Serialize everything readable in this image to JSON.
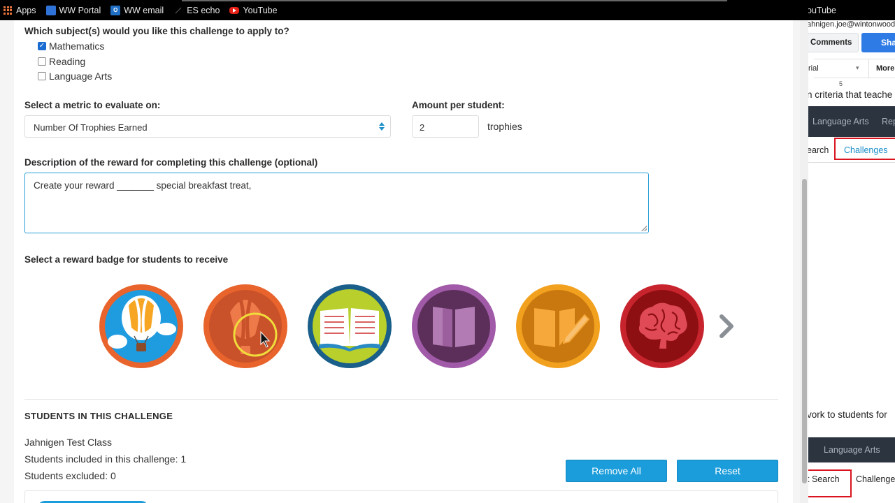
{
  "bookmarks": {
    "items": [
      {
        "label": "Apps",
        "icon": "apps-grid-icon"
      },
      {
        "label": "WW Portal",
        "icon": "portal-icon"
      },
      {
        "label": "WW email",
        "icon": "outlook-icon"
      },
      {
        "label": "ES echo",
        "icon": "echo-icon"
      },
      {
        "label": "YouTube",
        "icon": "youtube-icon"
      }
    ]
  },
  "form": {
    "subjects_label": "Which subject(s) would you like this challenge to apply to?",
    "subjects": [
      {
        "label": "Mathematics",
        "checked": true
      },
      {
        "label": "Reading",
        "checked": false
      },
      {
        "label": "Language Arts",
        "checked": false
      }
    ],
    "metric_label": "Select a metric to evaluate on:",
    "metric_value": "Number Of Trophies Earned",
    "amount_label": "Amount per student:",
    "amount_value": "2",
    "amount_unit": "trophies",
    "description_label": "Description of the reward for completing this challenge (optional)",
    "description_value": "Create your reward _______ special breakfast treat,",
    "badge_label": "Select a reward badge for students to receive",
    "badges": [
      {
        "icon": "hot-air-balloon-icon",
        "ring": "#e8642c",
        "fill": "#1f9be0"
      },
      {
        "icon": "hot-air-balloon-icon",
        "ring": "#e8642c",
        "fill": "#c9522a"
      },
      {
        "icon": "open-book-icon",
        "ring": "#1a5e8a",
        "fill": "#b8cf2c"
      },
      {
        "icon": "book-icon",
        "ring": "#a05aa8",
        "fill": "#5c2f5a"
      },
      {
        "icon": "writing-icon",
        "ring": "#f2a11f",
        "fill": "#c9780f"
      },
      {
        "icon": "brain-icon",
        "ring": "#c8242e",
        "fill": "#8e0f12"
      }
    ]
  },
  "students": {
    "title": "STUDENTS IN THIS CHALLENGE",
    "class_name": "Jahnigen Test Class",
    "included": "Students included in this challenge: 1",
    "excluded": "Students excluded: 0",
    "remove_all_label": "Remove All",
    "reset_label": "Reset"
  },
  "side_window": {
    "youtube_tab": "ouTube",
    "account": "ahnigen.joe@wintonwoods",
    "comments_label": "Comments",
    "share_label": "Sha",
    "font_name": "rial",
    "more_label": "More",
    "ruler_mark": "5",
    "doc_text_1": "n criteria that teache",
    "nav_language_arts": "Language Arts",
    "nav_rep": "Rep",
    "tab_search": "earch",
    "tab_challenges": "Challenges",
    "doc_text_2": "vork to students for",
    "nav_language_arts_2": "Language Arts",
    "tab_search_2": "t Search",
    "tab_challenges_2": "Challenge"
  }
}
